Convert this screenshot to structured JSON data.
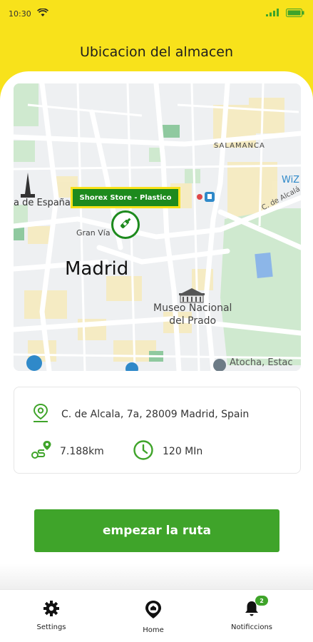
{
  "status_bar": {
    "time": "10:30"
  },
  "header": {
    "title": "Ubicacion del almacen"
  },
  "map": {
    "store_tag": "Shorex Store - Plastico",
    "labels": {
      "salamanca": "SALAMANCA",
      "espana": "a de España",
      "gran_via": "Gran Vía",
      "madrid": "Madrid",
      "museo": "Museo Nacional\ndel Prado",
      "atocha": "Atocha, Estac",
      "alcala": "C. de Alcalá",
      "wiz": "WiZ"
    }
  },
  "info": {
    "address": "C. de Alcala, 7a, 28009 Madrid, Spain",
    "distance": "7.188km",
    "duration": "120 MIn"
  },
  "cta": {
    "label": "empezar la ruta"
  },
  "nav": {
    "items": [
      {
        "label": "Settings"
      },
      {
        "label": "Home"
      },
      {
        "label": "Notificcions"
      }
    ],
    "badge": "2"
  },
  "colors": {
    "brand_yellow": "#f8e21b",
    "brand_green": "#3fa42a",
    "dark_green": "#1d8a1d"
  }
}
